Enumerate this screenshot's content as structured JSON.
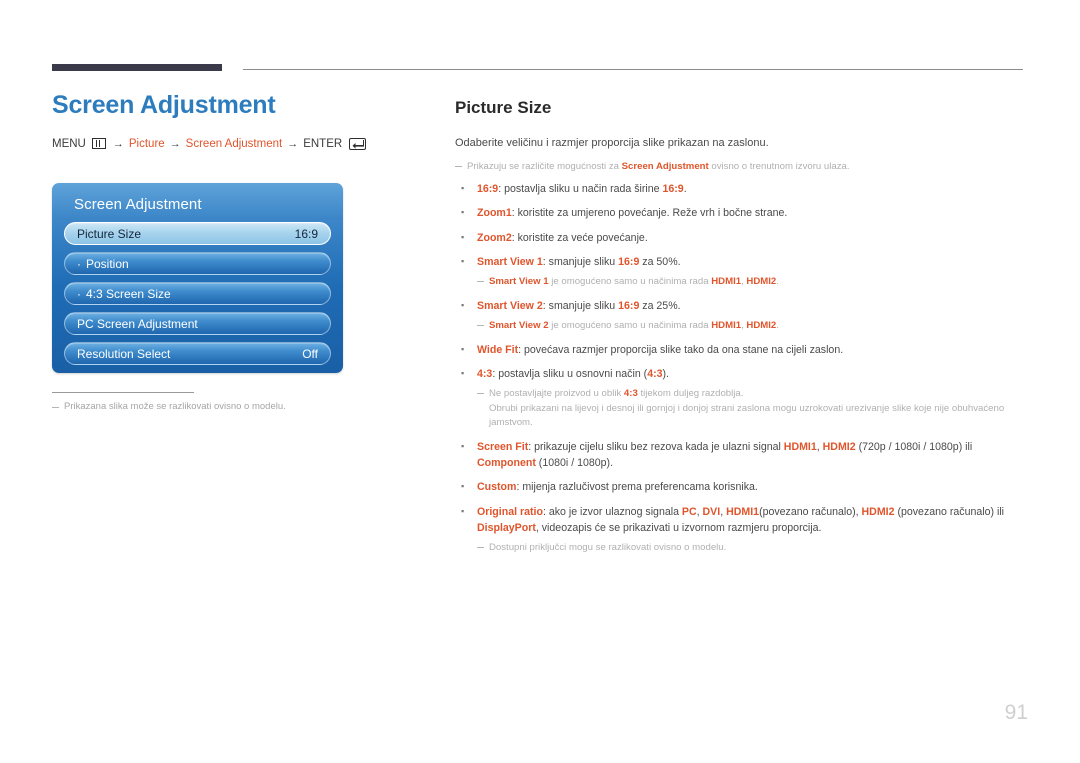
{
  "header": {
    "title": "Screen Adjustment",
    "breadcrumb": {
      "menu_label": "MENU",
      "menu_icon": "menu-bars-icon",
      "arrow": "→",
      "step1": "Picture",
      "step2": "Screen Adjustment",
      "enter_label": "ENTER",
      "enter_icon": "enter-return-icon"
    }
  },
  "osd": {
    "title": "Screen Adjustment",
    "rows": [
      {
        "label": "Picture Size",
        "value": "16:9",
        "selected": true,
        "dot": ""
      },
      {
        "label": "Position",
        "value": "",
        "selected": false,
        "dot": "·"
      },
      {
        "label": "4:3 Screen Size",
        "value": "",
        "selected": false,
        "dot": "·"
      },
      {
        "label": "PC Screen Adjustment",
        "value": "",
        "selected": false,
        "dot": ""
      },
      {
        "label": "Resolution Select",
        "value": "Off",
        "selected": false,
        "dot": ""
      }
    ]
  },
  "left_note": "Prikazana slika može se razlikovati ovisno o modelu.",
  "main": {
    "section_title": "Picture Size",
    "intro": "Odaberite veličinu i razmjer proporcija slike prikazan na zaslonu.",
    "top_note": {
      "before": "Prikazuju se različite mogućnosti za ",
      "bold": "Screen Adjustment",
      "after": " ovisno o trenutnom izvoru ulaza."
    },
    "items": [
      {
        "type": "bullet",
        "term": "16:9",
        "rest": ": postavlja sliku u način rada širine ",
        "tail_bold": "16:9",
        "tail": "."
      },
      {
        "type": "bullet",
        "term": "Zoom1",
        "rest": ": koristite za umjereno povećanje. Reže vrh i bočne strane.",
        "tail_bold": "",
        "tail": ""
      },
      {
        "type": "bullet",
        "term": "Zoom2",
        "rest": ": koristite za veće povećanje.",
        "tail_bold": "",
        "tail": ""
      },
      {
        "type": "bullet",
        "term": "Smart View 1",
        "rest": ": smanjuje sliku ",
        "tail_bold": "16:9",
        "tail": " za 50%."
      },
      {
        "type": "subnote",
        "bold_lead": "Smart View 1",
        "mid": " je omogućeno samo u načinima rada ",
        "bold_a": "HDMI1",
        "sep": ", ",
        "bold_b": "HDMI2",
        "end": "."
      },
      {
        "type": "bullet",
        "term": "Smart View 2",
        "rest": ": smanjuje sliku ",
        "tail_bold": "16:9",
        "tail": " za 25%."
      },
      {
        "type": "subnote",
        "bold_lead": "Smart View 2",
        "mid": " je omogućeno samo u načinima rada ",
        "bold_a": "HDMI1",
        "sep": ", ",
        "bold_b": "HDMI2",
        "end": "."
      },
      {
        "type": "bullet",
        "term": "Wide Fit",
        "rest": ": povećava razmjer proporcija slike tako da ona stane na cijeli zaslon.",
        "tail_bold": "",
        "tail": ""
      },
      {
        "type": "bullet",
        "term": "4:3",
        "rest": ": postavlja sliku u osnovni način (",
        "tail_bold": "4:3",
        "tail": ")."
      },
      {
        "type": "subnote_43",
        "lead": "Ne postavljajte proizvod u oblik ",
        "bold_a": "4:3",
        "after": " tijekom duljeg razdoblja.",
        "line2": "Obrubi prikazani na lijevoj i desnoj ili gornjoj i donjoj strani zaslona mogu uzrokovati urezivanje slike koje nije obuhvaćeno jamstvom."
      },
      {
        "type": "bullet_screenfit",
        "term": "Screen Fit",
        "p1": ": prikazuje cijelu sliku bez rezova kada je ulazni signal ",
        "b1": "HDMI1",
        "p2": ", ",
        "b2": "HDMI2",
        "p3": " (720p / 1080i / 1080p) ili ",
        "b3": "Component",
        "p4": " (1080i / 1080p)."
      },
      {
        "type": "bullet",
        "term": "Custom",
        "rest": ": mijenja razlučivost prema preferencama korisnika.",
        "tail_bold": "",
        "tail": ""
      },
      {
        "type": "bullet_original",
        "term": "Original ratio",
        "p1": ": ako je izvor ulaznog signala ",
        "b1": "PC",
        "p2": ", ",
        "b2": "DVI",
        "p3": ", ",
        "b3": "HDMI1",
        "p4": "(povezano računalo), ",
        "b4": "HDMI2",
        "p5": " (povezano računalo) ili ",
        "b5": "DisplayPort",
        "p6": ", videozapis će se prikazivati u izvornom razmjeru proporcija."
      },
      {
        "type": "note_plain",
        "text": "Dostupni priključci mogu se razlikovati ovisno o modelu."
      }
    ]
  },
  "page_number": "91",
  "colors": {
    "title_blue": "#2d7cbe",
    "accent_orange": "#e0552c",
    "note_gray": "#b0b0b0",
    "rule_dark": "#3b3a4a"
  }
}
